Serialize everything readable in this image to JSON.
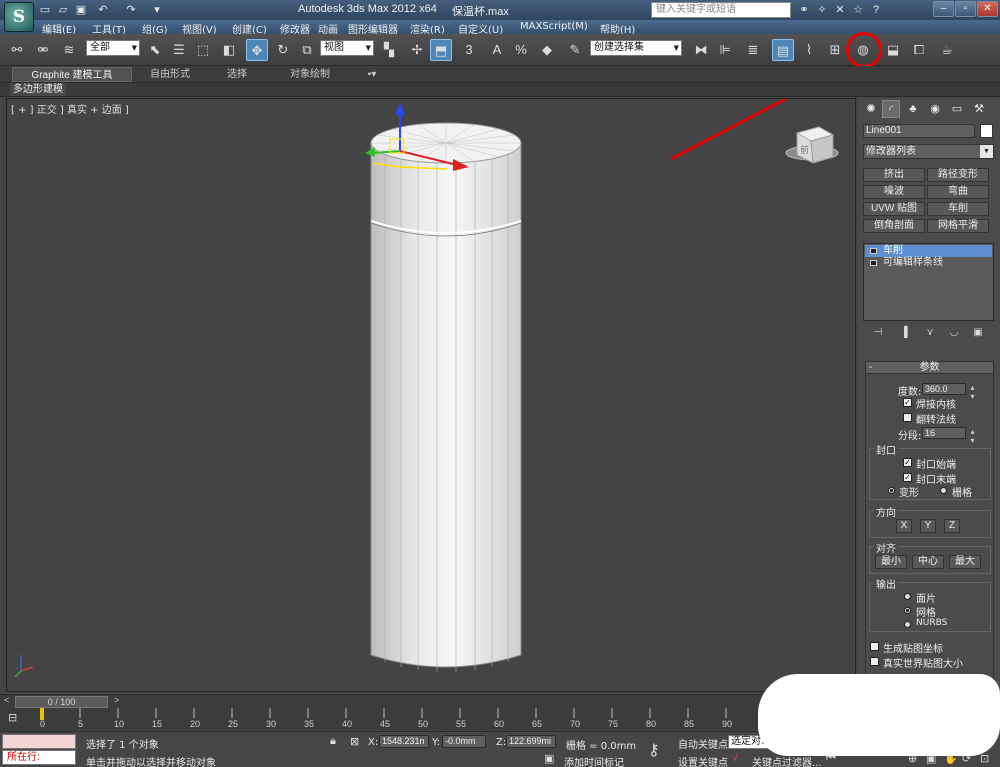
{
  "title": {
    "app": "Autodesk 3ds Max  2012 x64",
    "file": "保温杯.max",
    "search_placeholder": "键入关键字或短语"
  },
  "quick_access": {
    "icons": [
      "new-file-icon",
      "open-file-icon",
      "save-icon",
      "undo-icon",
      "redo-icon",
      "dropdown-arrow-icon"
    ]
  },
  "menu": {
    "items": [
      "编辑(E)",
      "工具(T)",
      "组(G)",
      "视图(V)",
      "创建(C)",
      "修改器",
      "动画",
      "图形编辑器",
      "渲染(R)",
      "自定义(U)",
      "MAXScript(M)",
      "帮助(H)"
    ]
  },
  "toolbar": {
    "selection_filter": "全部",
    "reference_coord": "视图",
    "named_selection": "创建选择集",
    "snap_labels": {
      "snap": "3",
      "angle": "A",
      "percent": "%",
      "spinner": "◆"
    }
  },
  "ribbon": {
    "tabs": [
      "Graphite 建模工具",
      "自由形式",
      "选择",
      "对象绘制"
    ],
    "panel_label": "多边形建模"
  },
  "viewport": {
    "label": "[ + ] 正交 ] 真实 + 边面 ]",
    "viewcube_face": "前"
  },
  "command_panel": {
    "object_name": "Line001",
    "modifier_list": "修改器列表",
    "modifier_buttons": [
      "挤出",
      "路径变形",
      "噪波",
      "弯曲",
      "UVW 贴图",
      "车削",
      "倒角剖面",
      "网格平滑"
    ],
    "stack": [
      "车削",
      "可编辑样条线"
    ],
    "rollout": "参数",
    "degrees_label": "度数:",
    "degrees_value": "360.0",
    "weld_core": "焊接内核",
    "flip_normals": "翻转法线",
    "segments_label": "分段:",
    "segments_value": "16",
    "cap_group": "封口",
    "cap_start": "封口始端",
    "cap_end": "封口末端",
    "morph": "变形",
    "grid": "栅格",
    "direction_group": "方向",
    "axes": [
      "X",
      "Y",
      "Z"
    ],
    "align_group": "对齐",
    "align_buttons": [
      "最小",
      "中心",
      "最大"
    ],
    "output_group": "输出",
    "output_options": [
      "面片",
      "网格",
      "NURBS"
    ],
    "gen_map_coords": "生成贴图坐标",
    "real_world_map": "真实世界贴图大小"
  },
  "timeline": {
    "frame_display": "0 / 100",
    "ticks": [
      "0",
      "5",
      "10",
      "15",
      "20",
      "25",
      "30",
      "35",
      "40",
      "45",
      "50",
      "55",
      "60",
      "65",
      "70",
      "75",
      "80",
      "85",
      "90"
    ]
  },
  "status": {
    "mode_text": "所在行:",
    "selection_text": "选择了 1 个对象",
    "prompt_text": "单击并拖动以选择并移动对象",
    "x_label": "X:",
    "x_value": "1548.231n",
    "y_label": "Y:",
    "y_value": "-0.0mm",
    "z_label": "Z:",
    "z_value": "122.699mi",
    "grid_text": "栅格 = 0.0mm",
    "add_time_tag": "添加时间标记",
    "auto_key": "自动关键点",
    "set_key": "设置关键点",
    "selected_drop": "选定对象",
    "key_filters": "关键点过滤器..."
  },
  "colors": {
    "accent_blue": "#4f86b8",
    "annotation_red": "#e00000",
    "viewport_bg": "#444444"
  }
}
